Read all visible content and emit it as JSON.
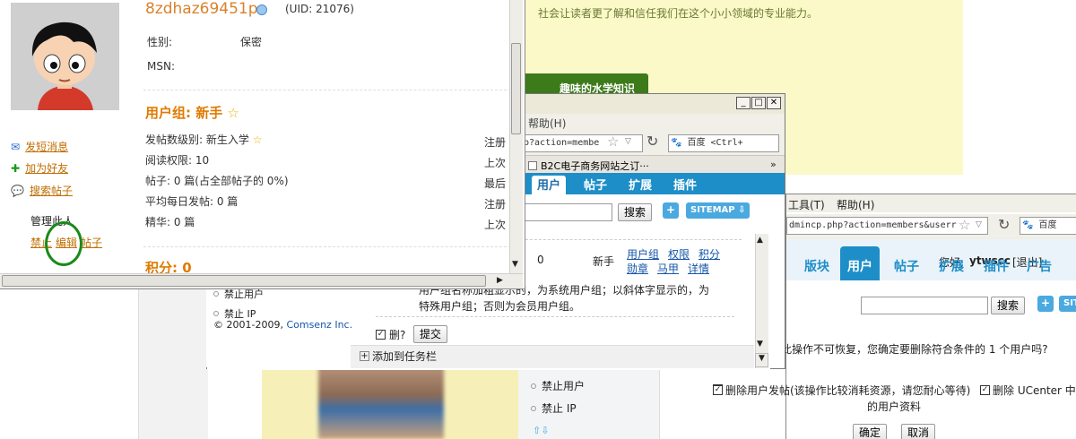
{
  "profile": {
    "username": "8zdhaz69451p",
    "uid": "(UID: 21076)",
    "gender_label": "性别:",
    "gender_value": "保密",
    "msn_label": "MSN:",
    "group_title": "用户组: 新手",
    "post_level": "发帖数级别: 新生入学",
    "read_perm": "阅读权限: 10",
    "posts": "帖子: 0 篇(占全部帖子的 0%)",
    "avg_posts": "平均每日发帖: 0 篇",
    "digest": "精华: 0 篇",
    "right_col": [
      "注册",
      "上次",
      "最后",
      "注册",
      "上次"
    ],
    "score": "积分: 0",
    "side_links": {
      "pm": "发短消息",
      "add_friend": "加为好友",
      "search_posts": "搜索帖子"
    },
    "admin_label": "管理此人",
    "admin_actions": [
      "禁止",
      "编辑",
      "帖子"
    ]
  },
  "background": {
    "green_text": "社会让读者更了解和信任我们在这个小小领域的专业能力。",
    "green_bar": "趣味的水学知识"
  },
  "mid_window": {
    "menu_help": "帮助(H)",
    "address": "p?action=membe",
    "search_engine": "百度 <Ctrl+",
    "tab_title": "B2C电子商务网站之订···",
    "nav_tabs": [
      "用户",
      "帖子",
      "扩展",
      "插件"
    ],
    "search_button": "搜索",
    "sitemap": "SITEMAP",
    "row_count": "0",
    "row_group": "新手",
    "row_links_1": [
      "用户组",
      "权限",
      "积分"
    ],
    "row_links_2": [
      "勋章",
      "马甲",
      "详情"
    ],
    "note_line1": "用户组名称加粗显示的，为系统用户组；以斜体字显示的，为",
    "note_line2": "特殊用户组；否则为会员用户组。",
    "delete_label": "删?",
    "submit_button": "提交",
    "add_taskbar": "添加到任务栏",
    "left_items": [
      "禁止用户",
      "禁止 IP"
    ],
    "copyright_prefix": "© 2001-2009, ",
    "copyright_link": "Comsenz Inc."
  },
  "right_window": {
    "menu_tools": "工具(T)",
    "menu_help": "帮助(H)",
    "address": "dmincp.php?action=members&userr",
    "search_engine": "百度",
    "greeting": "您好,",
    "user": "ytwscc",
    "logout": "[退出]",
    "nav_tabs": [
      "版块",
      "用户",
      "帖子",
      "扩展",
      "插件",
      "广告"
    ],
    "search_button": "搜索",
    "sitemap": "SIT",
    "confirm_text": "此操作不可恢复，您确定要删除符合条件的 1 个用户吗?",
    "option1": "删除用户发帖(该操作比较消耗资源，请您耐心等待)",
    "option2": "删除 UCenter 中",
    "option2_line2": "的用户资料",
    "ok": "确定",
    "cancel": "取消"
  },
  "bottom_left": {
    "items": [
      "禁止用户",
      "禁止 IP"
    ]
  },
  "colors": {
    "accent_orange": "#e07b00",
    "nav_blue": "#1e8ec8",
    "circle_green": "#1a8a1a"
  }
}
